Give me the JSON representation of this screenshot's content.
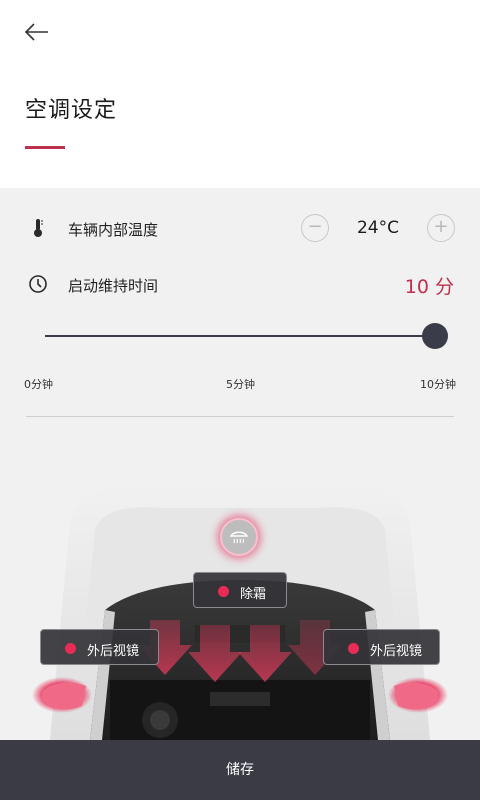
{
  "header": {
    "title": "空调设定",
    "accent_color": "#c0304d"
  },
  "temperature": {
    "label": "车辆内部温度",
    "value": "24°C",
    "minus": "−",
    "plus": "+"
  },
  "duration": {
    "label": "启动维持时间",
    "value": "10 分",
    "slider_fraction": 1.0,
    "ticks": [
      "0分钟",
      "5分钟",
      "10分钟"
    ]
  },
  "car": {
    "defrost_label": "除霜",
    "mirror_left_label": "外后视镜",
    "mirror_right_label": "外后视镜",
    "highlight_color": "#e82c55"
  },
  "footer": {
    "save_label": "储存"
  },
  "icons": {
    "back": "arrow-left-icon",
    "thermometer": "thermometer-icon",
    "clock": "clock-icon",
    "defrost": "defrost-icon"
  }
}
